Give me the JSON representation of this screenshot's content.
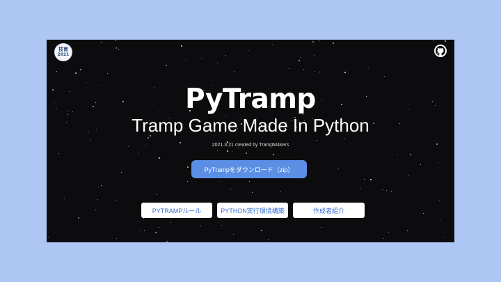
{
  "badge": {
    "line1": "技育",
    "line2": "2021"
  },
  "github": {
    "icon": "github-icon"
  },
  "hero": {
    "title": "PyTramp",
    "subtitle": "Tramp Game Made In Python",
    "credit": "2021.3.21 created by TrampM4kers"
  },
  "download": {
    "label": "PyTrampをダウンロード（zip）"
  },
  "nav": [
    {
      "label": "PYTRAMPルール"
    },
    {
      "label": "PYTHON実行環境構築"
    },
    {
      "label": "作成者紹介"
    }
  ],
  "colors": {
    "background": "#aec6f4",
    "panel": "#0c0c0e",
    "download_button": "#5b8fe6",
    "link_text": "#3b6fd0"
  }
}
